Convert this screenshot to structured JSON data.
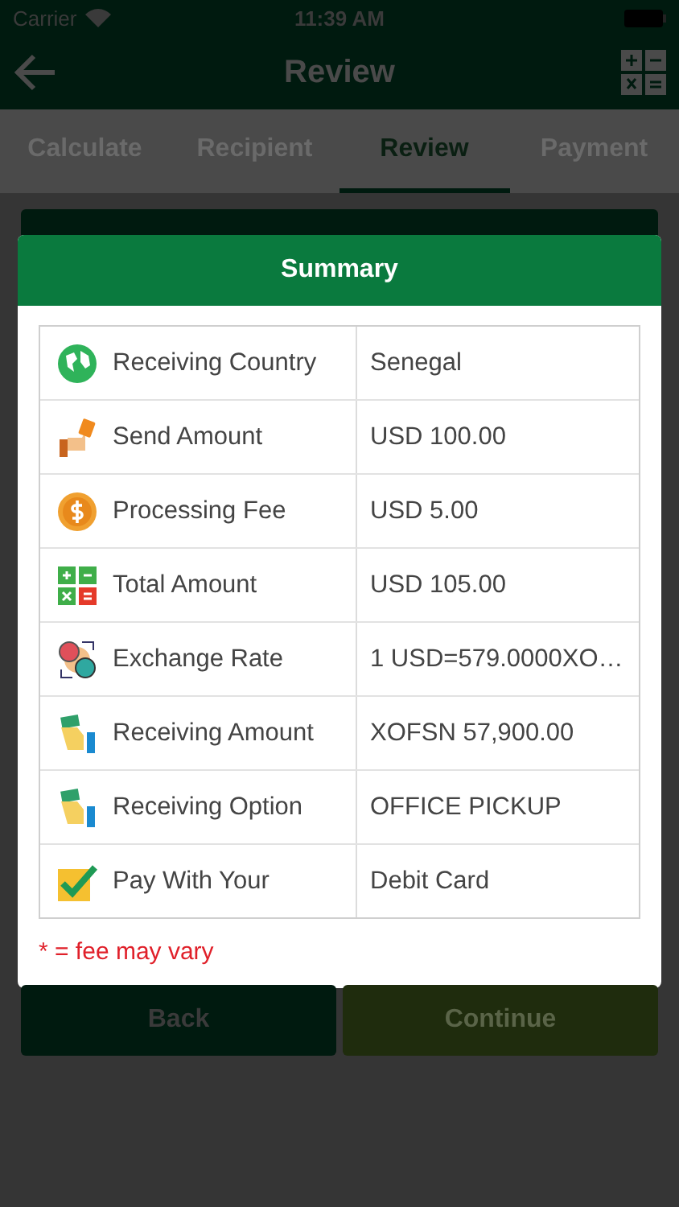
{
  "status_bar": {
    "carrier": "Carrier",
    "time": "11:39 AM"
  },
  "header": {
    "title": "Review"
  },
  "tabs": [
    {
      "label": "Calculate",
      "selected": false
    },
    {
      "label": "Recipient",
      "selected": false
    },
    {
      "label": "Review",
      "selected": true
    },
    {
      "label": "Payment",
      "selected": false
    }
  ],
  "summary": {
    "title": "Summary",
    "rows": [
      {
        "label": "Receiving Country",
        "value": "Senegal"
      },
      {
        "label": "Send Amount",
        "value": "USD 100.00"
      },
      {
        "label": "Processing Fee",
        "value": "USD 5.00"
      },
      {
        "label": "Total Amount",
        "value": "USD 105.00"
      },
      {
        "label": "Exchange Rate",
        "value": "1 USD=579.0000XO…"
      },
      {
        "label": "Receiving Amount",
        "value": "XOFSN 57,900.00"
      },
      {
        "label": "Receiving Option",
        "value": "OFFICE PICKUP"
      },
      {
        "label": "Pay With Your",
        "value": "Debit Card"
      }
    ],
    "note": "* = fee may vary"
  },
  "buttons": [
    {
      "label": "Back",
      "kind": "secondary"
    },
    {
      "label": "Continue",
      "kind": "primary"
    }
  ]
}
